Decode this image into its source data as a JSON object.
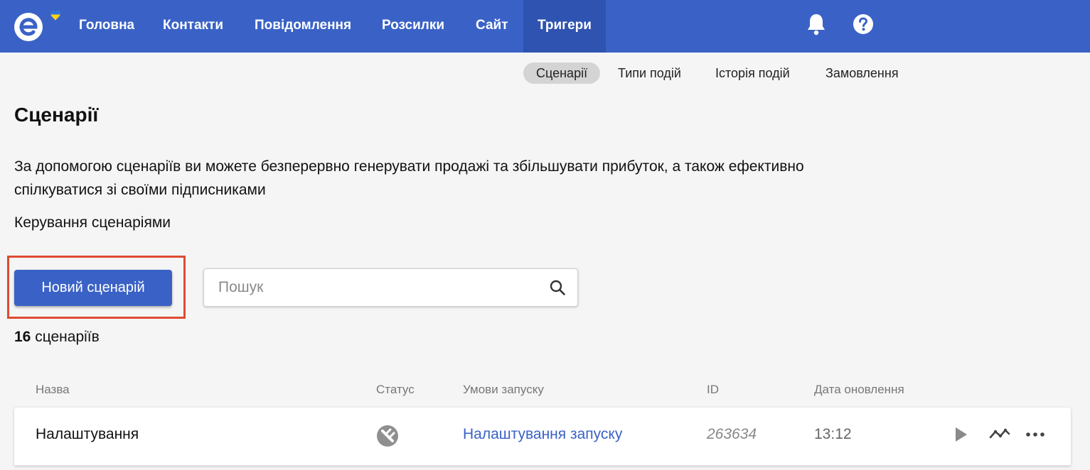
{
  "app": {
    "logo_icon": "envelope-e-logo-icon",
    "accent_color": "#3a62c6"
  },
  "nav": {
    "items": [
      {
        "label": "Головна"
      },
      {
        "label": "Контакти"
      },
      {
        "label": "Повідомлення"
      },
      {
        "label": "Розсилки"
      },
      {
        "label": "Сайт"
      },
      {
        "label": "Тригери",
        "active": true
      }
    ],
    "icons": [
      "bell-icon",
      "help-icon"
    ]
  },
  "subnav": {
    "items": [
      {
        "label": "Сценарії",
        "active": true
      },
      {
        "label": "Типи подій"
      },
      {
        "label": "Історія подій"
      },
      {
        "label": "Замовлення"
      }
    ]
  },
  "page": {
    "title": "Сценарії",
    "description": "За допомогою сценаріїв ви можете безперервно генерувати продажі та збільшувати прибуток, а також ефективно спілкуватися зі своїми підписниками",
    "manage_label": "Керування сценаріями",
    "highlight_color": "#e04a34"
  },
  "toolbar": {
    "new_button_label": "Новий сценарій",
    "search_placeholder": "Пошук"
  },
  "summary": {
    "count": "16",
    "count_label": "сценаріїв"
  },
  "table": {
    "columns": [
      "Назва",
      "Статус",
      "Умови запуску",
      "ID",
      "Дата оновлення"
    ],
    "rows": [
      {
        "name": "Налаштування",
        "status_icon": "disabled-status-icon",
        "launch_conditions": "Налаштування запуску",
        "id": "263634",
        "updated": "13:12",
        "actions": [
          "play-icon",
          "stats-icon",
          "more-icon"
        ]
      }
    ]
  }
}
